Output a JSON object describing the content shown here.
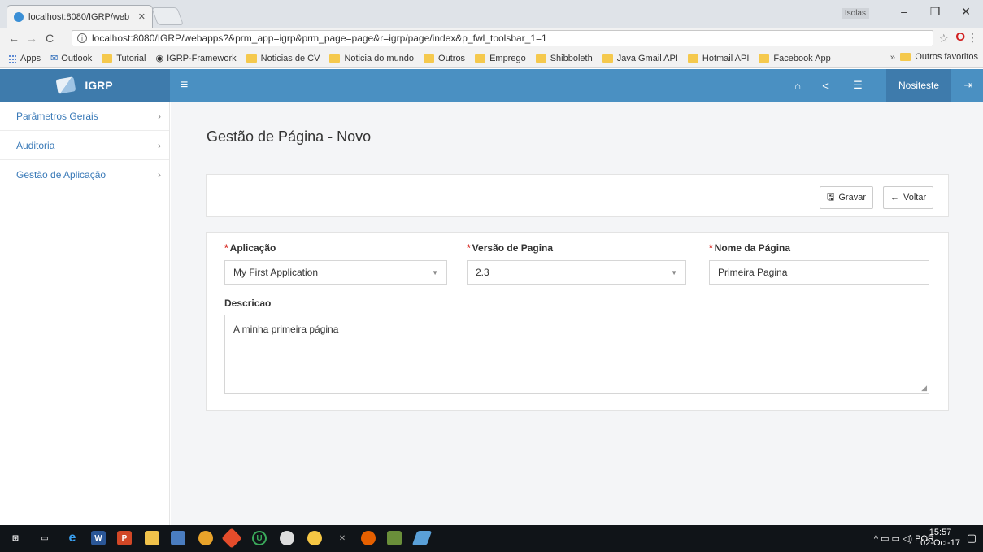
{
  "browser": {
    "tab_title": "localhost:8080/IGRP/web",
    "tab_close": "✕",
    "user_badge": "Isolas",
    "url": "localhost:8080/IGRP/webapps?&prm_app=igrp&prm_page=page&r=igrp/page/index&p_fwl_toolsbar_1=1",
    "bookmarks": [
      "Apps",
      "Outlook",
      "Tutorial",
      "IGRP-Framework",
      "Noticias de CV",
      "Noticia do mundo",
      "Outros",
      "Emprego",
      "Shibboleth",
      "Java Gmail API",
      "Hotmail API",
      "Facebook App"
    ],
    "bookmarks_more": "»",
    "other_bookmarks": "Outros favoritos"
  },
  "header": {
    "brand": "IGRP",
    "user": "Nositeste"
  },
  "sidebar": {
    "items": [
      {
        "label": "Parâmetros Gerais"
      },
      {
        "label": "Auditoria"
      },
      {
        "label": "Gestão de Aplicação"
      }
    ]
  },
  "page": {
    "title": "Gestão de Página - Novo"
  },
  "toolbar": {
    "save_label": "Gravar",
    "back_label": "Voltar"
  },
  "form": {
    "aplicacao": {
      "label": "Aplicação",
      "value": "My First Application"
    },
    "versao": {
      "label": "Versão de Pagina",
      "value": "2.3"
    },
    "nome": {
      "label": "Nome da Página",
      "value": "Primeira Pagina"
    },
    "descricao": {
      "label": "Descricao",
      "value": "A minha primeira página"
    }
  },
  "taskbar": {
    "lang": "POR",
    "time": "15:57",
    "date": "02-Oct-17"
  },
  "colors": {
    "header": "#4a90c2",
    "brand": "#3e7bac",
    "link": "#3a7ab8",
    "required": "#d9312a"
  }
}
